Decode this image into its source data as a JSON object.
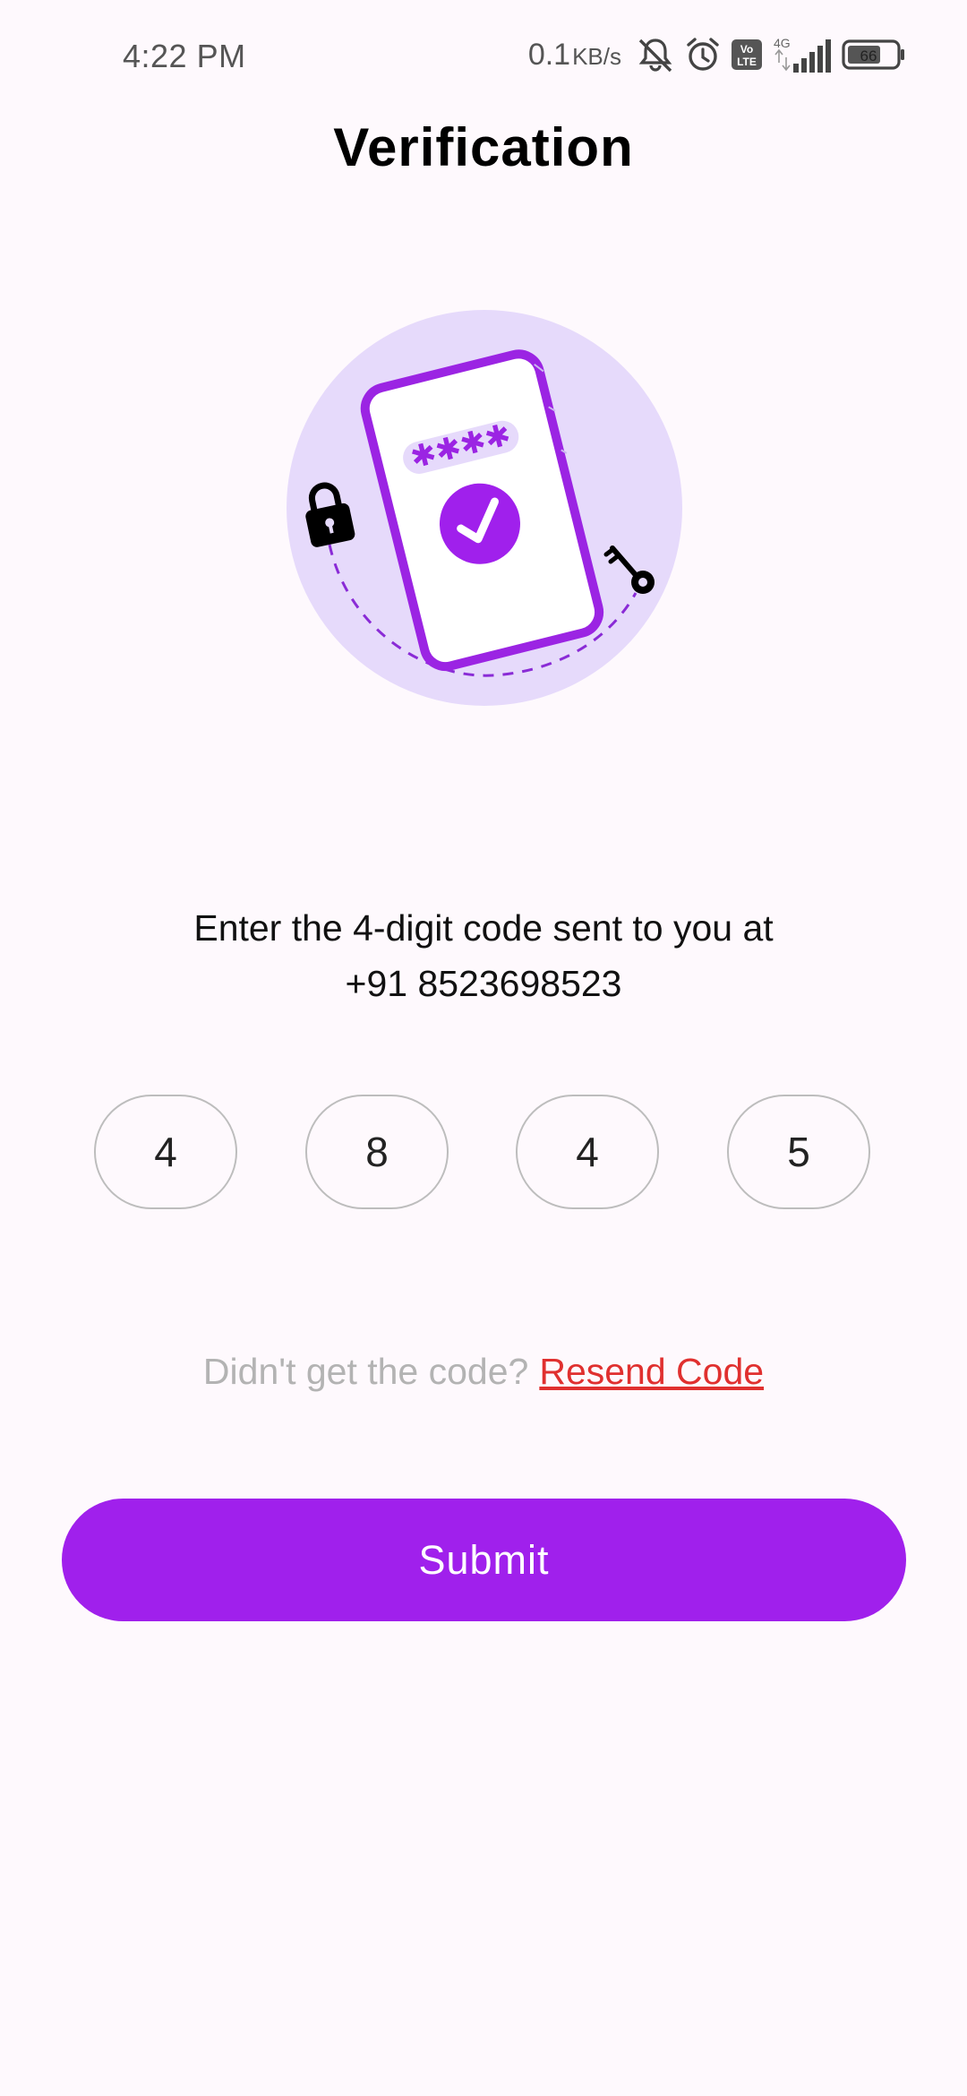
{
  "status_bar": {
    "time": "4:22 PM",
    "net_speed": "0.1",
    "net_unit": "KB/s",
    "network_label": "4G",
    "volte_label": "Vo LTE",
    "battery_level": "66",
    "icons": [
      "bell-muted-icon",
      "alarm-icon",
      "volte-icon",
      "signal-icon",
      "battery-icon"
    ]
  },
  "header": {
    "title": "Verification"
  },
  "illustration": {
    "masked_code": "✱✱✱✱",
    "icons": [
      "phone-icon",
      "check-icon",
      "padlock-icon",
      "key-icon"
    ],
    "colors": {
      "circle": "#e6dafb",
      "phone": "#9b24e3",
      "accent": "#a020ec"
    }
  },
  "instruction": {
    "line1": "Enter the 4-digit code sent to you at",
    "line2": "+91 8523698523"
  },
  "otp": {
    "digits": [
      "4",
      "8",
      "4",
      "5"
    ]
  },
  "resend": {
    "prompt": "Didn't get the code?",
    "link_label": "Resend Code"
  },
  "submit": {
    "label": "Submit"
  },
  "colors": {
    "background": "#fef9fd",
    "primary": "#a020ec",
    "link": "#e0302f",
    "muted_text": "#b3b3b3",
    "otp_border": "#bdbdbd"
  }
}
